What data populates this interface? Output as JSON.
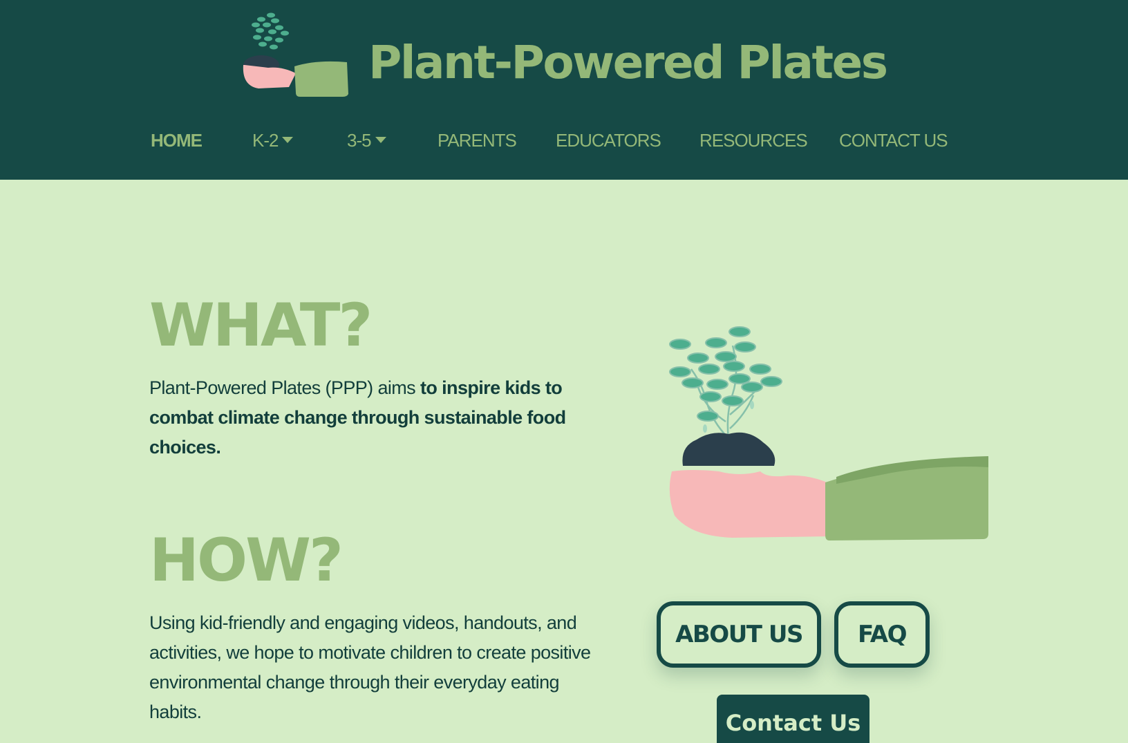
{
  "header": {
    "site_title": "Plant-Powered Plates",
    "logo_icon": "hand-holding-sprout-icon"
  },
  "nav": {
    "items": [
      {
        "label": "HOME",
        "active": true
      },
      {
        "label": "K-2",
        "dropdown": true
      },
      {
        "label": "3-5",
        "dropdown": true
      },
      {
        "label": "PARENTS"
      },
      {
        "label": "EDUCATORS"
      },
      {
        "label": "RESOURCES"
      },
      {
        "label": "CONTACT US"
      }
    ]
  },
  "what": {
    "heading": "WHAT?",
    "text_intro": "Plant-Powered Plates (PPP) aims ",
    "text_bold": "to inspire kids to combat climate change through sustainable food choices."
  },
  "how": {
    "heading": "HOW?",
    "text": "Using kid-friendly and engaging videos, handouts, and activities, we hope to motivate children to create positive environmental change through their everyday eating habits."
  },
  "buttons": {
    "about_us": "ABOUT US",
    "faq": "FAQ",
    "contact_us": "Contact Us"
  },
  "illustration": {
    "icon": "hand-holding-sprout-icon"
  },
  "colors": {
    "header_bg": "#164a46",
    "page_bg": "#d5edc6",
    "accent_green": "#94b878",
    "text_dark": "#123e3b",
    "hand_pink": "#f7b8b8",
    "soil": "#2b3f4c",
    "leaf": "#4dae8e"
  }
}
